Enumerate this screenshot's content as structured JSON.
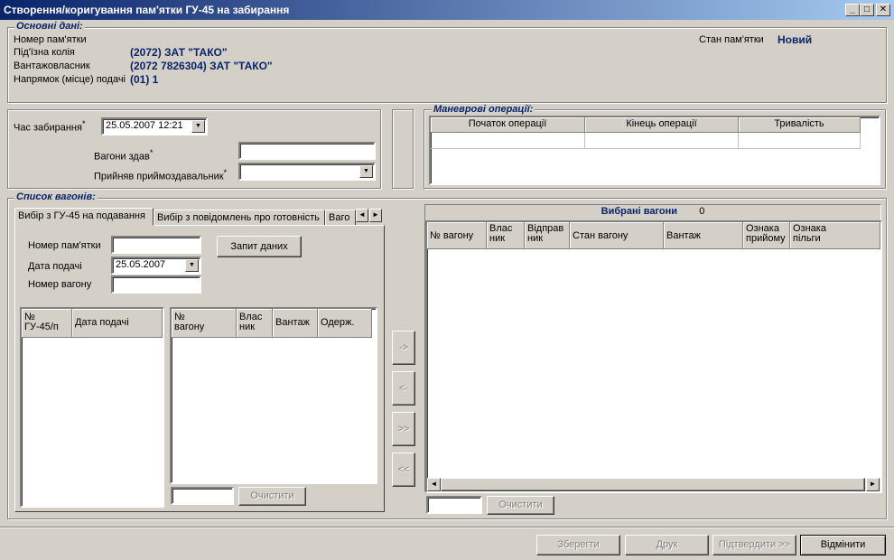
{
  "window": {
    "title": "Створення/коригування пам'ятки ГУ-45 на забирання",
    "minimize": "_",
    "maximize": "□",
    "close": "✕"
  },
  "main": {
    "legend": "Основні дані:",
    "memo_number_label": "Номер пам'ятки",
    "siding_label": "Під'їзна колія",
    "siding_value": "(2072) ЗАТ \"ТАКО\"",
    "owner_label": "Вантажовласник",
    "owner_value": "(2072 7826304) ЗАТ \"ТАКО\"",
    "direction_label": "Напрямок (місце) подачі",
    "direction_value": "(01) 1",
    "status_label": "Стан пам'ятки",
    "status_value": "Новий"
  },
  "pickup": {
    "time_label": "Час забирання",
    "time_value": "25.05.2007 12:21",
    "handed_label": "Вагони здав",
    "handed_value": "",
    "received_label": "Прийняв приймоздавальник",
    "received_value": ""
  },
  "shunting": {
    "legend": "Маневрові операції:",
    "columns": [
      "Початок операції",
      "Кінець операції",
      "Тривалість"
    ]
  },
  "wagons": {
    "legend": "Список вагонів:",
    "tabs": [
      "Вибір з ГУ-45 на подавання",
      "Вибір з повідомлень про готовність",
      "Ваго"
    ],
    "memo_number_label": "Номер пам'ятки",
    "memo_number_value": "",
    "request_button": "Запит даних",
    "date_label": "Дата подачі",
    "date_value": "25.05.2007",
    "wagon_number_label": "Номер вагону",
    "wagon_number_value": "",
    "left_grid_columns": [
      "№\nГУ-45/п",
      "Дата подачі"
    ],
    "middle_grid_columns": [
      "№\nвагону",
      "Влас\nник",
      "Вантаж",
      "Одерж."
    ],
    "clear_button": "Очистити",
    "move_right": "->",
    "move_left": "<-",
    "move_all_right": ">>",
    "move_all_left": "<<"
  },
  "selected": {
    "title": "Вибрані вагони",
    "count": "0",
    "columns": [
      "№ вагону",
      "Влас\nник",
      "Відправ\nник",
      "Стан вагону",
      "Вантаж",
      "Ознака\nприйому",
      "Ознака\nпільги"
    ],
    "clear_button": "Очистити"
  },
  "footer": {
    "save": "Зберегти",
    "print": "Друк",
    "confirm": "Підтвердити >>",
    "cancel": "Відмінити"
  },
  "icons": {
    "dropdown": "▼",
    "scroll_left": "◄",
    "scroll_right": "►"
  }
}
